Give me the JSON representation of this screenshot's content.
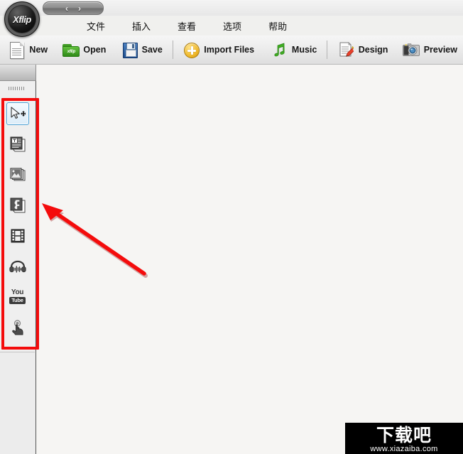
{
  "app": {
    "logo_text": "Xflip",
    "nav": {
      "back": "‹",
      "forward": "›"
    }
  },
  "menubar": {
    "items": [
      {
        "label": "文件",
        "name": "menu-file"
      },
      {
        "label": "插入",
        "name": "menu-insert"
      },
      {
        "label": "查看",
        "name": "menu-view"
      },
      {
        "label": "选项",
        "name": "menu-options"
      },
      {
        "label": "帮助",
        "name": "menu-help"
      }
    ]
  },
  "toolbar": {
    "items": [
      {
        "label": "New",
        "icon": "document-icon"
      },
      {
        "label": "Open",
        "icon": "folder-open-icon",
        "badge": "xflip"
      },
      {
        "label": "Save",
        "icon": "floppy-disk-icon"
      },
      {
        "label": "Import Files",
        "icon": "plus-circle-icon"
      },
      {
        "label": "Music",
        "icon": "music-note-icon"
      },
      {
        "label": "Design",
        "icon": "document-pencil-icon"
      },
      {
        "label": "Preview",
        "icon": "camera-icon"
      }
    ]
  },
  "sidebar": {
    "tools": [
      {
        "name": "select-move-tool",
        "icon": "cursor-move-icon",
        "selected": true
      },
      {
        "name": "text-tool",
        "icon": "text-box-icon",
        "selected": false
      },
      {
        "name": "image-tool",
        "icon": "image-icon",
        "selected": false
      },
      {
        "name": "flash-tool",
        "icon": "flash-f-icon",
        "selected": false
      },
      {
        "name": "video-tool",
        "icon": "film-strip-icon",
        "selected": false
      },
      {
        "name": "audio-tool",
        "icon": "headphones-icon",
        "selected": false
      },
      {
        "name": "youtube-tool",
        "icon": "youtube-icon",
        "selected": false
      },
      {
        "name": "button-tool",
        "icon": "click-hand-icon",
        "selected": false
      }
    ],
    "youtube_top": "You",
    "youtube_bottom": "Tube"
  },
  "annotations": {
    "highlight_color": "#f40c0c",
    "arrow_color": "#f40c0c"
  },
  "watermark": {
    "text_cn": "下载吧",
    "url": "www.xiazaiba.com"
  },
  "colors": {
    "canvas_bg": "#f6f5f3",
    "sidebar_bg": "#ececec",
    "panel_bg": "#efefef",
    "toolbar_bg": "#ebebeb",
    "selection_border": "#4a9fd4"
  }
}
